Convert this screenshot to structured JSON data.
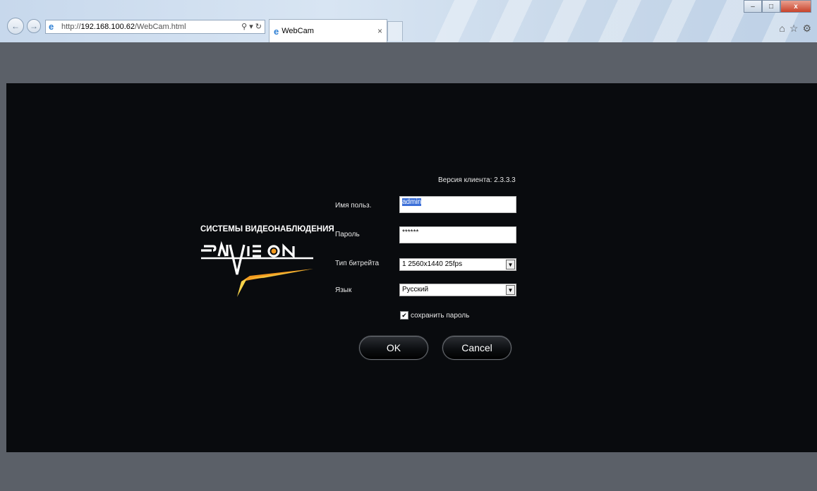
{
  "browser": {
    "url_scheme": "http://",
    "url_host": "192.168.100.62",
    "url_path": "/WebCam.html",
    "tab_title": "WebCam",
    "tab_close": "×",
    "icons": [
      "back-arrow-icon",
      "forward-arrow-icon",
      "ie-logo-icon",
      "search-icon",
      "refresh-icon",
      "home-icon",
      "star-icon",
      "gear-icon"
    ]
  },
  "brand": {
    "tagline": "СИСТЕМЫ ВИДЕОНАБЛЮДЕНИЯ",
    "logo_text": "SATVISION",
    "colors": {
      "accent_orange": "#f39a1e",
      "accent_yellow": "#f5d24a"
    }
  },
  "login": {
    "version": "Версия клиента:  2.3.3.3",
    "username_label": "Имя польз.",
    "username_value": "admin",
    "password_label": "Пароль",
    "password_value": "******",
    "bitrate_label": "Тип битрейта",
    "bitrate_value": "1 2560x1440 25fps",
    "language_label": "Язык",
    "language_value": "Русский",
    "remember_label": "сохранить пароль",
    "remember_checked": true,
    "ok_label": "OK",
    "cancel_label": "Cancel"
  }
}
